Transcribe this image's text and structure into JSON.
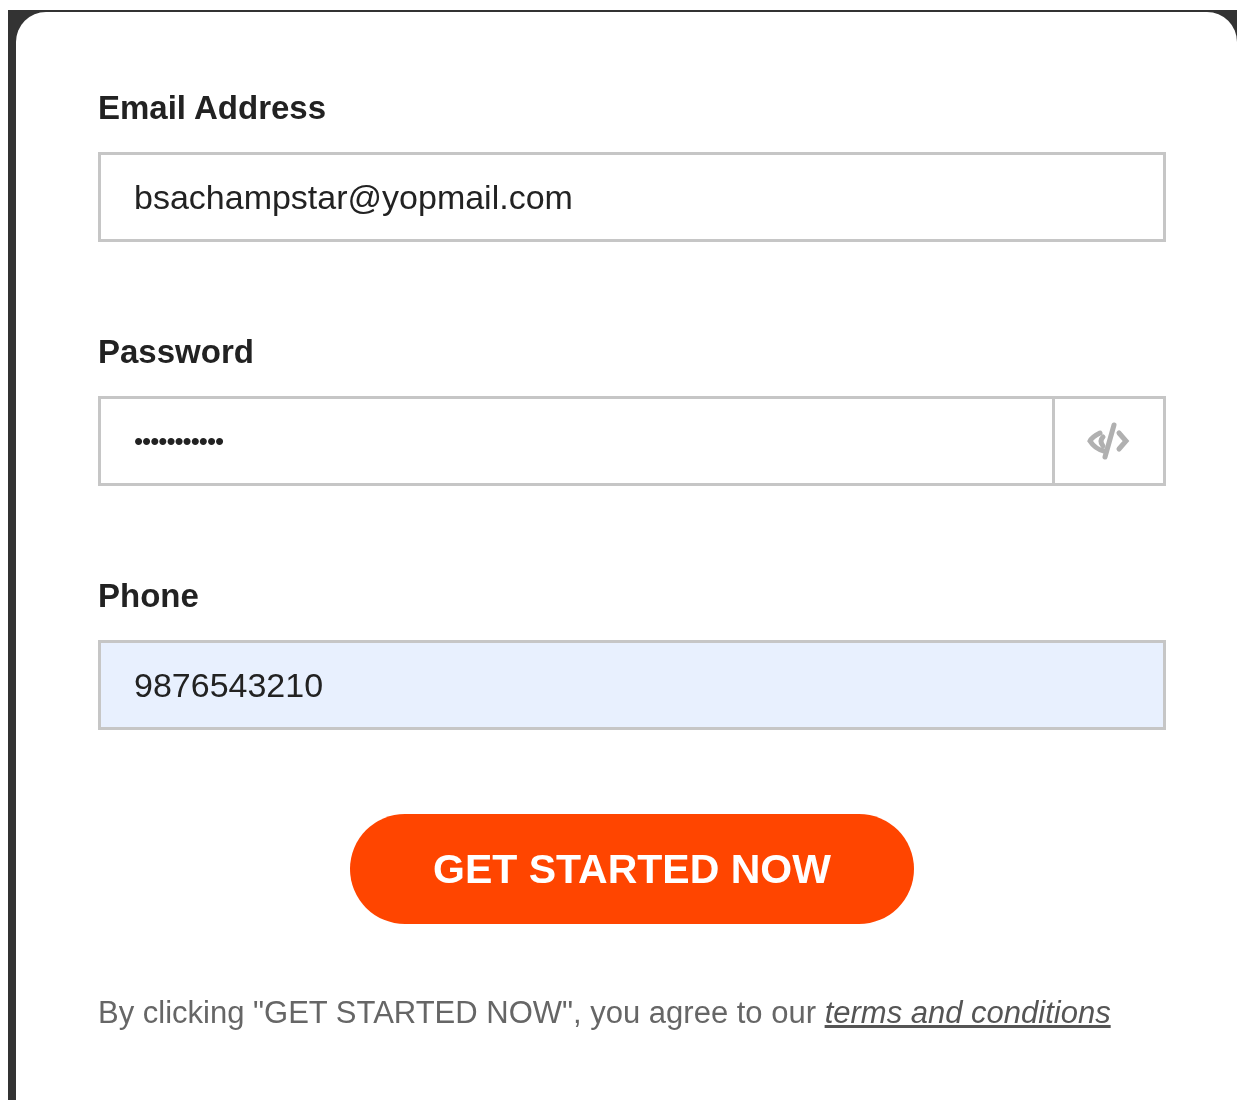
{
  "fields": [
    {
      "kind": "text",
      "label": "Email Address",
      "value": "bsachampstar@yopmail.com",
      "autofilled": false
    },
    {
      "kind": "password",
      "label": "Password",
      "value": "•••••••••••",
      "autofilled": false
    },
    {
      "kind": "text",
      "label": "Phone",
      "value": "9876543210",
      "autofilled": true
    }
  ],
  "submit_button": "GET STARTED NOW",
  "terms": {
    "text": "By clicking \"GET STARTED NOW\", you agree to our ",
    "link": "terms and conditions"
  }
}
